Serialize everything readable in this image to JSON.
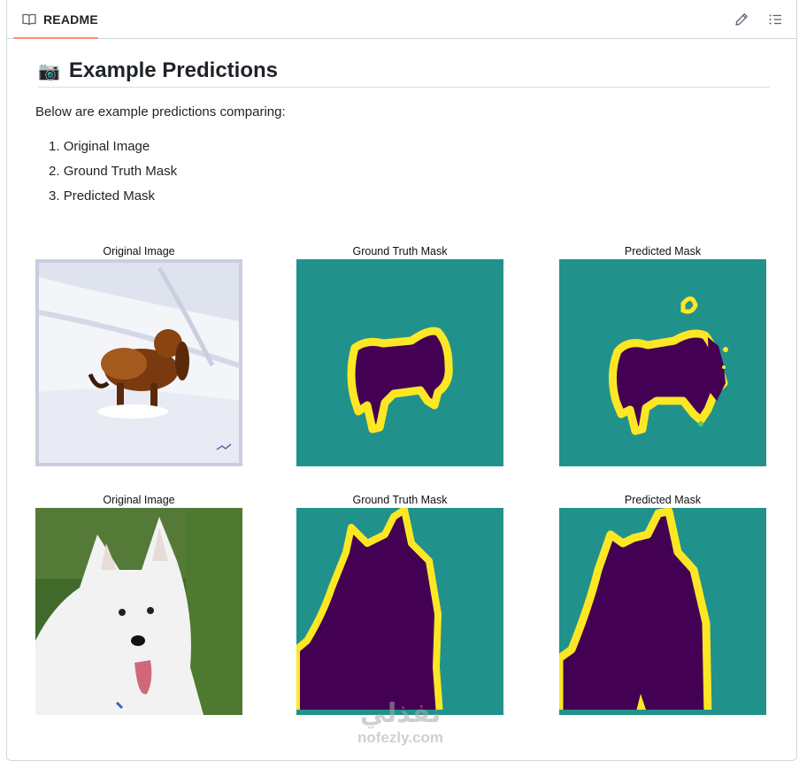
{
  "readme": {
    "tab_label": "README",
    "tab_icon": "book-icon",
    "edit_icon": "pencil-icon",
    "outline_icon": "list-icon"
  },
  "section": {
    "emoji": "📷",
    "title": "Example Predictions",
    "intro": "Below are example predictions comparing:",
    "list": [
      "Original Image",
      "Ground Truth Mask",
      "Predicted Mask"
    ]
  },
  "figures": {
    "row1": {
      "original_title": "Original Image",
      "gt_title": "Ground Truth Mask",
      "pred_title": "Predicted Mask"
    },
    "row2": {
      "original_title": "Original Image",
      "gt_title": "Ground Truth Mask",
      "pred_title": "Predicted Mask"
    }
  },
  "colors": {
    "mask_background": "#21918c",
    "mask_foreground": "#440154",
    "mask_boundary": "#fde725",
    "tab_underline": "#fd8c73"
  },
  "watermark": {
    "text": "nofezly.com"
  }
}
